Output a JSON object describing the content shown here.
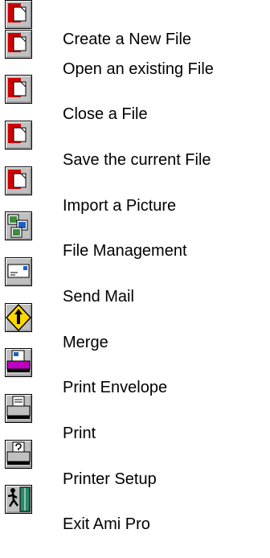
{
  "toolbar_icons": {
    "items": [
      {
        "icon": "new-file-icon",
        "label": "Create a New File"
      },
      {
        "icon": "open-file-icon",
        "label": "Open an existing File"
      },
      {
        "icon": "close-file-icon",
        "label": "Close a File"
      },
      {
        "icon": "save-file-icon",
        "label": "Save the current File"
      },
      {
        "icon": "import-picture-icon",
        "label": "Import a Picture"
      },
      {
        "icon": "file-management-icon",
        "label": "File Management"
      },
      {
        "icon": "send-mail-icon",
        "label": "Send Mail"
      },
      {
        "icon": "merge-icon",
        "label": "Merge"
      },
      {
        "icon": "print-envelope-icon",
        "label": "Print Envelope"
      },
      {
        "icon": "print-icon",
        "label": "Print"
      },
      {
        "icon": "printer-setup-icon",
        "label": "Printer Setup"
      },
      {
        "icon": "exit-icon",
        "label": "Exit Ami Pro"
      }
    ]
  }
}
